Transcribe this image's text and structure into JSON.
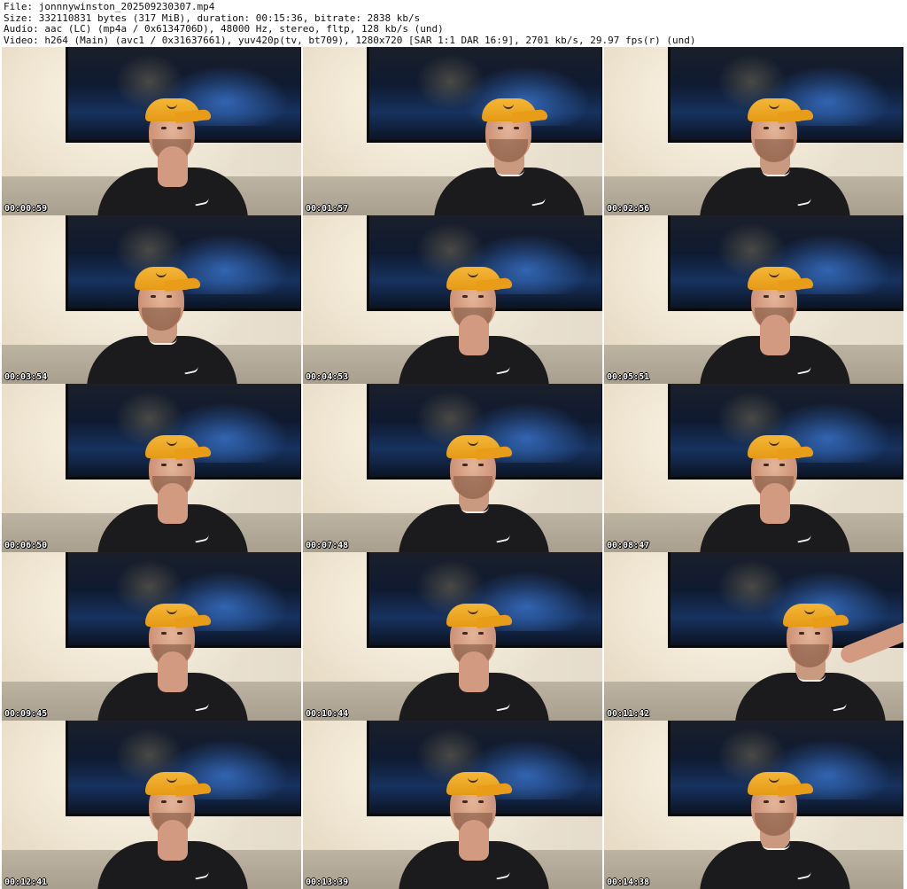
{
  "header": {
    "file_line": "File: jonnnywinston_202509230307.mp4",
    "size_line": "Size: 332110831 bytes (317 MiB), duration: 00:15:36, bitrate: 2838 kb/s",
    "audio_line": "Audio: aac (LC) (mp4a / 0x6134706D), 48000 Hz, stereo, fltp, 128 kb/s (und)",
    "video_line": "Video: h264 (Main) (avc1 / 0x31637661), yuv420p(tv, bt709), 1280x720 [SAR 1:1 DAR 16:9], 2701 kb/s, 29.97 fps(r) (und)"
  },
  "thumbnails": [
    {
      "timestamp": "00:00:59"
    },
    {
      "timestamp": "00:01:57"
    },
    {
      "timestamp": "00:02:56"
    },
    {
      "timestamp": "00:03:54"
    },
    {
      "timestamp": "00:04:53"
    },
    {
      "timestamp": "00:05:51"
    },
    {
      "timestamp": "00:06:50"
    },
    {
      "timestamp": "00:07:48"
    },
    {
      "timestamp": "00:08:47"
    },
    {
      "timestamp": "00:09:45"
    },
    {
      "timestamp": "00:10:44"
    },
    {
      "timestamp": "00:11:42"
    },
    {
      "timestamp": "00:12:41"
    },
    {
      "timestamp": "00:13:39"
    },
    {
      "timestamp": "00:14:38"
    }
  ]
}
